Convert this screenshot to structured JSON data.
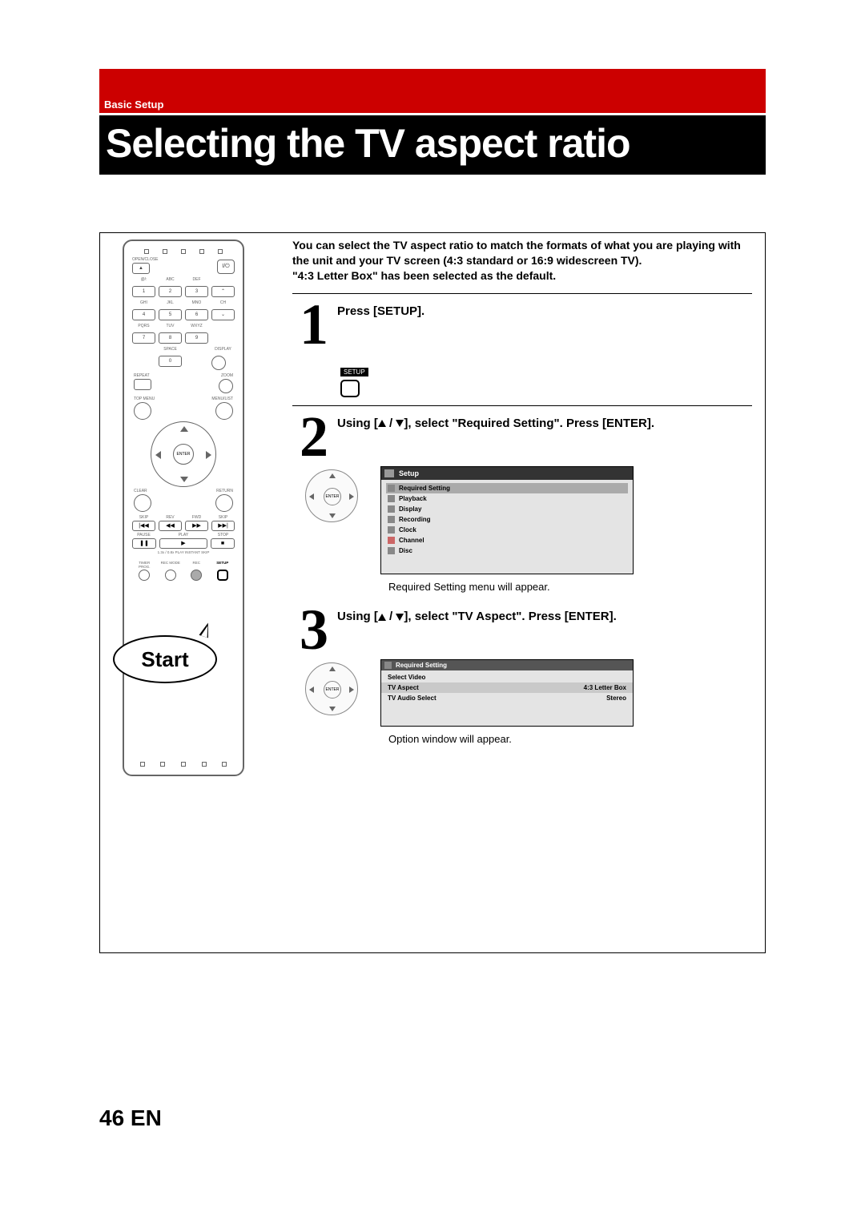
{
  "section": "Basic Setup",
  "title": "Selecting the TV aspect ratio",
  "intro_lines": [
    "You can select the TV aspect ratio to match the formats of what you are playing with the unit and your TV screen (4:3 standard or 16:9 widescreen TV).",
    "\"4:3 Letter Box\" has been selected as the default."
  ],
  "remote": {
    "open_close": "OPEN/CLOSE",
    "power": "I/⏻",
    "key_labels_row1": [
      "@/:",
      "ABC",
      "DEF",
      ""
    ],
    "keys_row1": [
      "1",
      "2",
      "3",
      "⌃"
    ],
    "key_labels_row2": [
      "GHI",
      "JKL",
      "MNO",
      "CH"
    ],
    "keys_row2": [
      "4",
      "5",
      "6",
      "⌄"
    ],
    "key_labels_row3": [
      "PQRS",
      "TUV",
      "WXYZ",
      ""
    ],
    "keys_row3": [
      "7",
      "8",
      "9",
      ""
    ],
    "key_labels_row4": [
      "",
      "SPACE",
      "",
      "DISPLAY"
    ],
    "keys_row4": [
      "",
      "0",
      "",
      ""
    ],
    "repeat": "REPEAT",
    "zoom": "ZOOM",
    "top_menu": "TOP MENU",
    "menu_list": "MENU/LIST",
    "enter": "ENTER",
    "clear": "CLEAR",
    "return": "RETURN",
    "tport_labels1": [
      "SKIP",
      "REV",
      "FWD",
      "SKIP"
    ],
    "tport1": [
      "|◀◀",
      "◀◀",
      "▶▶",
      "▶▶|"
    ],
    "tport_labels2": [
      "PAUSE",
      "PLAY",
      "",
      "STOP"
    ],
    "tport2": [
      "❚❚",
      "▶",
      "",
      "■"
    ],
    "extra_label": "1.3x / 0.8x PLAY  INSTANT SKIP",
    "bottom_labels": [
      "TIMER PROG.",
      "REC MODE",
      "REC",
      "SETUP"
    ],
    "start_bubble": "Start"
  },
  "steps": [
    {
      "num": "1",
      "text": "Press [SETUP].",
      "icon_label": "SETUP"
    },
    {
      "num": "2",
      "text_parts": [
        "Using [",
        " / ",
        "], select \"Required Setting\". Press [ENTER]."
      ],
      "osd": {
        "header": "Setup",
        "items": [
          "Required Setting",
          "Playback",
          "Display",
          "Recording",
          "Clock",
          "Channel",
          "Disc"
        ]
      },
      "caption": "Required Setting menu will appear."
    },
    {
      "num": "3",
      "text_parts": [
        "Using [",
        " / ",
        "], select \"TV Aspect\". Press [ENTER]."
      ],
      "osd": {
        "header": "Required Setting",
        "rows": [
          {
            "label": "Select Video",
            "value": ""
          },
          {
            "label": "TV Aspect",
            "value": "4:3 Letter Box"
          },
          {
            "label": "TV Audio Select",
            "value": "Stereo"
          }
        ]
      },
      "caption": "Option window will appear."
    }
  ],
  "page_footer": "46  EN"
}
